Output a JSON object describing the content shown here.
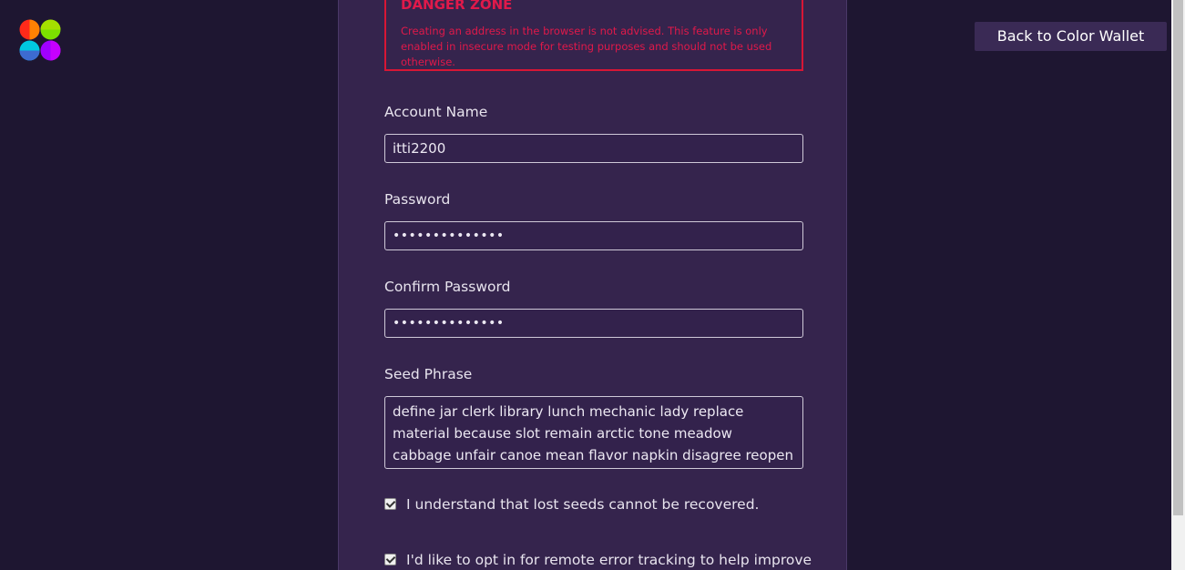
{
  "header": {
    "back_label": "Back to Color Wallet"
  },
  "logo": {
    "colors": [
      "#ff2a1a",
      "#7be000",
      "#00c8e0",
      "#a000ff",
      "#3d6bd0",
      "#ff9000"
    ]
  },
  "danger_zone": {
    "title": "DANGER ZONE",
    "message": "Creating an address in the browser is not advised. This feature is only enabled in insecure mode for testing purposes and should not be used otherwise."
  },
  "form": {
    "account_name_label": "Account Name",
    "account_name_value": "itti2200",
    "password_label": "Password",
    "password_value": "••••••••••••••",
    "confirm_password_label": "Confirm Password",
    "confirm_password_value": "••••••••••••••",
    "seed_phrase_label": "Seed Phrase",
    "seed_phrase_value": "define jar clerk library lunch mechanic lady replace material because slot remain arctic tone meadow cabbage unfair canoe mean flavor napkin disagree reopen napkin",
    "lost_seeds_label": "I understand that lost seeds cannot be recovered.",
    "lost_seeds_checked": true,
    "error_tracking_label": "I'd like to opt in for remote error tracking to help improve",
    "error_tracking_checked": true
  },
  "colors": {
    "background": "#1e1631",
    "panel": "#35244d",
    "danger": "#e0194a",
    "button": "#3a2a55"
  }
}
